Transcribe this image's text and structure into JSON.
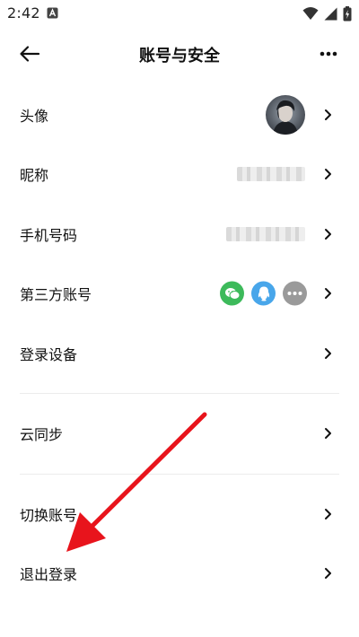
{
  "status_bar": {
    "time": "2:42"
  },
  "header": {
    "title": "账号与安全"
  },
  "rows": {
    "avatar": {
      "label": "头像"
    },
    "nickname": {
      "label": "昵称"
    },
    "phone": {
      "label": "手机号码"
    },
    "third_party": {
      "label": "第三方账号",
      "icons": [
        {
          "name": "wechat-icon",
          "color": "#3dba5b"
        },
        {
          "name": "qq-icon",
          "color": "#48a6ea"
        },
        {
          "name": "more-accounts-icon",
          "color": "#9a9a9a"
        }
      ]
    },
    "devices": {
      "label": "登录设备"
    },
    "cloud_sync": {
      "label": "云同步"
    },
    "switch_account": {
      "label": "切换账号"
    },
    "logout": {
      "label": "退出登录"
    }
  },
  "annotation": {
    "arrow_color": "#e8141c"
  }
}
